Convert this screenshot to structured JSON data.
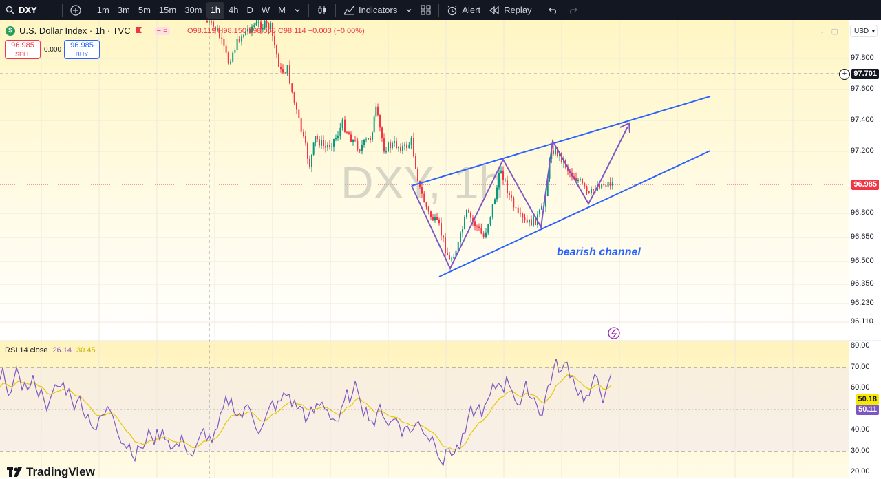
{
  "toolbar": {
    "symbol": "DXY",
    "timeframes": [
      "1m",
      "3m",
      "5m",
      "15m",
      "30m",
      "1h",
      "4h",
      "D",
      "W",
      "M"
    ],
    "active_timeframe": "1h",
    "indicators_label": "Indicators",
    "alert_label": "Alert",
    "replay_label": "Replay"
  },
  "legend": {
    "title": "U.S. Dollar Index · 1h · TVC",
    "ohlc": "O98.119 H98.150 L98.058 C98.114 −0.003 (−0.00%)",
    "sell_price": "96.985",
    "sell_label": "SELL",
    "buy_price": "96.985",
    "buy_label": "BUY",
    "spread": "0.000"
  },
  "watermark": "DXY, 1h",
  "annotation": "bearish channel",
  "currency_button": "USD",
  "price_axis": [
    "97.800",
    "97.600",
    "97.400",
    "97.200",
    "96.800",
    "96.650",
    "96.500",
    "96.350",
    "96.230",
    "96.110"
  ],
  "price_tags": {
    "crosshair": "97.701",
    "last": "96.985"
  },
  "rsi": {
    "label": "RSI 14 close",
    "value": "26.14",
    "ma_value": "30.45",
    "axis": [
      "80.00",
      "70.00",
      "60.00",
      "40.00",
      "30.00",
      "20.00"
    ],
    "tag_ma": "50.18",
    "tag_rsi": "50.11"
  },
  "brand": "TradingView",
  "colors": {
    "up": "#089981",
    "down": "#f23645",
    "channel": "#2962ff",
    "zigzag": "#7e57c2",
    "rsi_line": "#7e57c2",
    "rsi_ma": "#e6c800",
    "bg_tint": "#fffbe0"
  }
}
